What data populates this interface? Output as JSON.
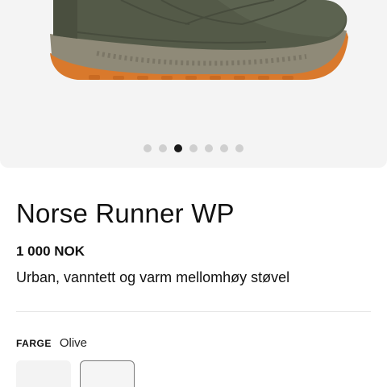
{
  "gallery": {
    "image_alt": "Olive winter boot with orange sole",
    "dot_count": 7,
    "active_index": 2
  },
  "product": {
    "title": "Norse Runner WP",
    "price": "1 000 NOK",
    "description": "Urban, vanntett og varm mellomhøy støvel"
  },
  "color": {
    "label": "FARGE",
    "value": "Olive",
    "swatches": [
      {
        "name": "variant-1",
        "selected": false
      },
      {
        "name": "olive",
        "selected": true
      }
    ]
  },
  "colors": {
    "boot": "#545a48",
    "sole_mid": "#8f8a78",
    "outsole": "#d9792c",
    "page_background": "#f4f4f4",
    "active_dot": "#1a1a1a",
    "inactive_dot": "#cfcfcf"
  }
}
